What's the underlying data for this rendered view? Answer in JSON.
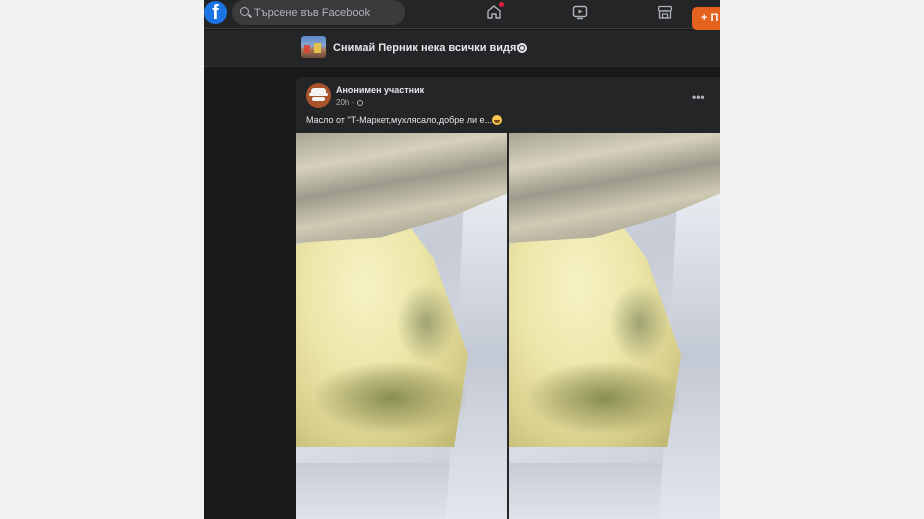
{
  "topbar": {
    "logo_letter": "f",
    "search_placeholder": "Търсене във Facebook",
    "icons": [
      "facebook-logo",
      "search-icon",
      "home-icon",
      "video-icon",
      "marketplace-icon"
    ]
  },
  "group": {
    "title": "Снимай Перник нека всички видят!",
    "join_label": "+ П"
  },
  "post": {
    "author": "Анонимен участник",
    "time": "20h ·",
    "caption": "Масло от \"Т-Маркет,мухлясало,добре ли е...",
    "more": "•••",
    "photos": [
      "butter-photo",
      "butter-photo"
    ]
  },
  "colors": {
    "background": "#18191a",
    "surface": "#242526",
    "text": "#e4e6eb",
    "muted": "#b0b3b8",
    "brand": "#1b74e4",
    "accent": "#e4621d"
  }
}
